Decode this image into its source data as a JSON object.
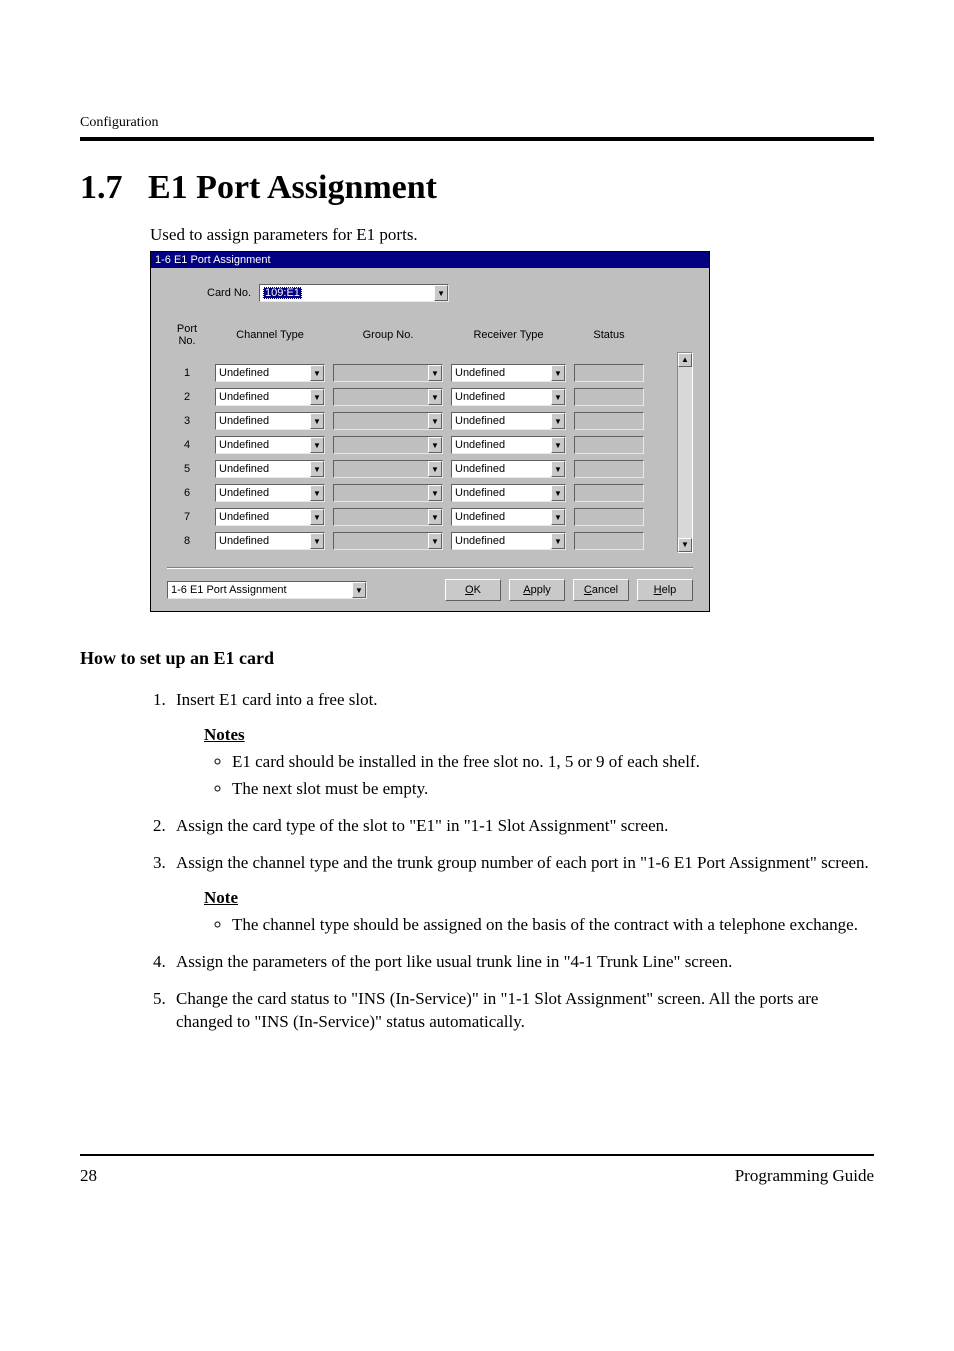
{
  "running_head": "Configuration",
  "heading_num": "1.7",
  "heading_title": "E1 Port Assignment",
  "intro": "Used to assign parameters for E1 ports.",
  "window": {
    "title": "1-6 E1 Port Assignment",
    "card_no_label": "Card No.",
    "card_no_value": "109:E1",
    "columns": {
      "port": "Port\nNo.",
      "channel": "Channel Type",
      "group": "Group No.",
      "receiver": "Receiver Type",
      "status": "Status"
    },
    "rows": [
      {
        "port": "1",
        "channel": "Undefined",
        "group": "",
        "receiver": "Undefined",
        "status": ""
      },
      {
        "port": "2",
        "channel": "Undefined",
        "group": "",
        "receiver": "Undefined",
        "status": ""
      },
      {
        "port": "3",
        "channel": "Undefined",
        "group": "",
        "receiver": "Undefined",
        "status": ""
      },
      {
        "port": "4",
        "channel": "Undefined",
        "group": "",
        "receiver": "Undefined",
        "status": ""
      },
      {
        "port": "5",
        "channel": "Undefined",
        "group": "",
        "receiver": "Undefined",
        "status": ""
      },
      {
        "port": "6",
        "channel": "Undefined",
        "group": "",
        "receiver": "Undefined",
        "status": ""
      },
      {
        "port": "7",
        "channel": "Undefined",
        "group": "",
        "receiver": "Undefined",
        "status": ""
      },
      {
        "port": "8",
        "channel": "Undefined",
        "group": "",
        "receiver": "Undefined",
        "status": ""
      }
    ],
    "footer_combo": "1-6 E1 Port Assignment",
    "buttons": {
      "ok_u": "O",
      "ok_r": "K",
      "apply_u": "A",
      "apply_r": "pply",
      "cancel_u": "C",
      "cancel_r": "ancel",
      "help_u": "H",
      "help_r": "elp"
    }
  },
  "howto_heading": "How to set up an E1 card",
  "steps": {
    "s1": "Insert E1 card into a free slot.",
    "notes1_head": "Notes",
    "notes1": [
      "E1 card should be installed in the free slot no. 1, 5 or 9 of each shelf.",
      "The next slot must be empty."
    ],
    "s2": "Assign the card type of the slot to \"E1\" in \"1-1 Slot Assignment\" screen.",
    "s3": "Assign the channel type and the trunk group number of each port in \"1-6 E1 Port Assignment\" screen.",
    "note2_head": "Note",
    "notes2": [
      "The channel type should be assigned on the basis of the contract with a telephone exchange."
    ],
    "s4": "Assign the parameters of the port like usual trunk line in \"4-1 Trunk Line\" screen.",
    "s5": "Change the card status to \"INS (In-Service)\" in \"1-1 Slot Assignment\" screen. All the ports are changed to \"INS (In-Service)\" status automatically."
  },
  "footer": {
    "page": "28",
    "guide": "Programming Guide"
  }
}
